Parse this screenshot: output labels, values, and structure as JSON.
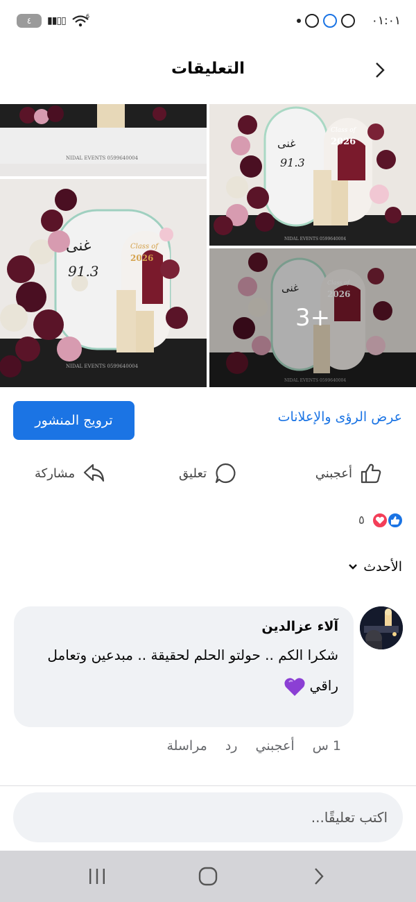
{
  "status": {
    "time": "٠١:٠١",
    "battery": "٤",
    "network_badge": "6"
  },
  "header": {
    "title": "التعليقات"
  },
  "photos": {
    "more_label": "3+",
    "watermark": "NIDAL EVENTS 0599640004",
    "sign_name": "غنى",
    "sign_number": "91.3",
    "class_text": "Class of",
    "class_year": "2026"
  },
  "actions": {
    "promote_label": "ترويج المنشور",
    "insights_label": "عرض الرؤى والإعلانات",
    "like_label": "أعجبني",
    "comment_label": "تعليق",
    "share_label": "مشاركة"
  },
  "reactions": {
    "count": "٥"
  },
  "sort": {
    "label": "الأحدث"
  },
  "comment": {
    "author": "آلاء عزالدين",
    "text": "شكرا الكم .. حولتو الحلم لحقيقة .. مبدعين وتعامل راقي",
    "time": "1 س",
    "like": "أعجبني",
    "reply": "رد",
    "message": "مراسلة"
  },
  "composer": {
    "placeholder": "اكتب تعليقًا..."
  },
  "colors": {
    "accent": "#1b74e4",
    "bubble": "#f0f2f5",
    "love": "#f33e58",
    "meta": "#65676b",
    "navbar": "#d4d4d8"
  },
  "icons": {
    "back": "chevron-right-icon",
    "like": "thumbs-up-icon",
    "comment": "speech-bubble-icon",
    "share": "share-arrow-icon",
    "sort": "chevron-down-icon",
    "heart_emoji": "purple-heart-icon"
  }
}
